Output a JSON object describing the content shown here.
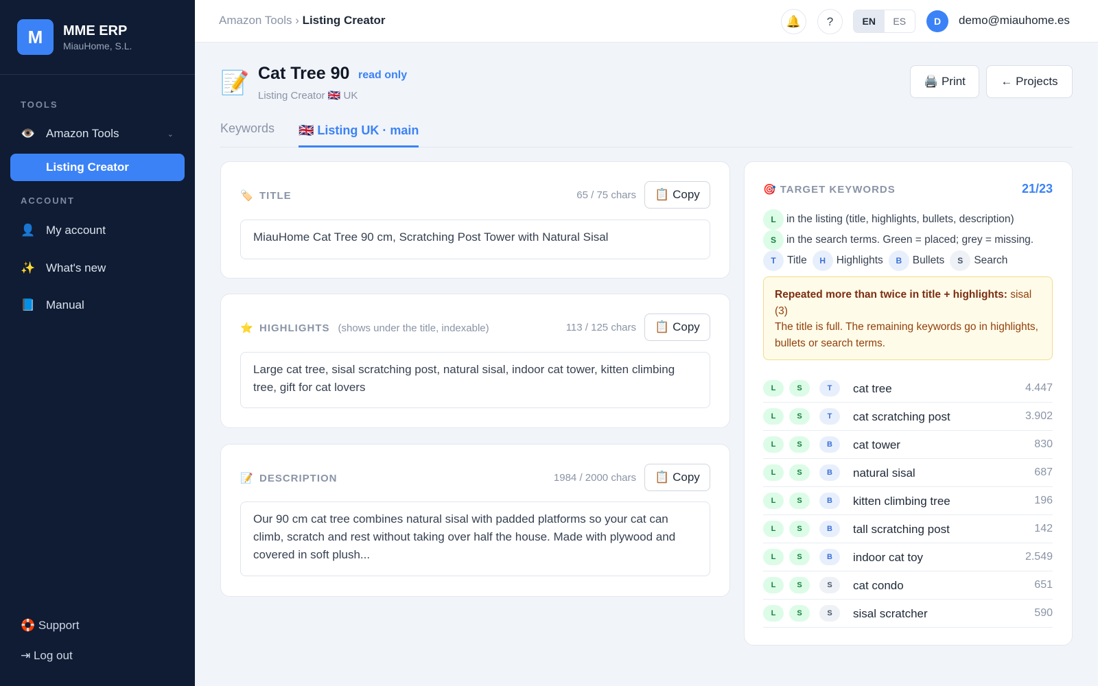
{
  "sidebar": {
    "logo_letter": "M",
    "brand_name": "MME ERP",
    "brand_sub": "MiauHome, S.L.",
    "tools_label": "TOOLS",
    "account_label": "ACCOUNT",
    "amazon_tools": {
      "icon": "👁️",
      "label": "Amazon Tools",
      "chevron": "⌄"
    },
    "listing_creator": "Listing Creator",
    "my_account": {
      "icon": "👤",
      "label": "My account"
    },
    "whats_new": {
      "icon": "✨",
      "label": "What's new"
    },
    "manual": {
      "icon": "📘",
      "label": "Manual"
    },
    "support": "🛟 Support",
    "logout": "⇥ Log out"
  },
  "topbar": {
    "crumb_parent": "Amazon Tools",
    "crumb_sep": " › ",
    "crumb_current": "Listing Creator",
    "bell_icon": "🔔",
    "help_icon": "?",
    "lang_en": "EN",
    "lang_es": "ES",
    "avatar_letter": "D",
    "email": "demo@miauhome.es"
  },
  "header": {
    "icon": "📝",
    "title": "Cat Tree 90",
    "readonly": "read only",
    "subtitle": "Listing Creator 🇬🇧 UK",
    "print_label": "🖨️ Print",
    "projects_label": "← Projects"
  },
  "tabs": {
    "keywords": "Keywords",
    "listing": "🇬🇧 Listing UK · main"
  },
  "title_card": {
    "icon": "🏷️",
    "label": "TITLE",
    "chars": "65 / 75 chars",
    "copy": "📋 Copy",
    "text": "MiauHome Cat Tree 90 cm, Scratching Post Tower with Natural Sisal"
  },
  "highlights_card": {
    "icon": "⭐",
    "label": "HIGHLIGHTS",
    "hint": "(shows under the title, indexable)",
    "chars": "113 / 125 chars",
    "copy": "📋 Copy",
    "text": "Large cat tree, sisal scratching post, natural sisal, indoor cat tower, kitten climbing tree, gift for cat lovers"
  },
  "description_card": {
    "icon": "📝",
    "label": "DESCRIPTION",
    "chars": "1984 / 2000 chars",
    "copy": "📋 Copy",
    "text": "Our 90 cm cat tree combines natural sisal with padded platforms so your cat can climb, scratch and rest without taking over half the house. Made with plywood and covered in soft plush..."
  },
  "keywords_panel": {
    "icon": "🎯",
    "label": "TARGET KEYWORDS",
    "count": "21/23",
    "legend_l": "in the listing (title, highlights, bullets, description)",
    "legend_s": "in the search terms. Green = placed; grey = missing.",
    "legend_t": "Title",
    "legend_h": "Highlights",
    "legend_b": "Bullets",
    "legend_search": "Search",
    "warning_bold": "Repeated more than twice in title + highlights:",
    "warning_rest": " sisal (3)",
    "warning_line2": "The title is full. The remaining keywords go in highlights, bullets or search terms.",
    "rows": [
      {
        "l": "L",
        "s": "S",
        "loc": "T",
        "keyword": "cat tree",
        "volume": "4.447"
      },
      {
        "l": "L",
        "s": "S",
        "loc": "T",
        "keyword": "cat scratching post",
        "volume": "3.902"
      },
      {
        "l": "L",
        "s": "S",
        "loc": "B",
        "keyword": "cat tower",
        "volume": "830"
      },
      {
        "l": "L",
        "s": "S",
        "loc": "B",
        "keyword": "natural sisal",
        "volume": "687"
      },
      {
        "l": "L",
        "s": "S",
        "loc": "B",
        "keyword": "kitten climbing tree",
        "volume": "196"
      },
      {
        "l": "L",
        "s": "S",
        "loc": "B",
        "keyword": "tall scratching post",
        "volume": "142"
      },
      {
        "l": "L",
        "s": "S",
        "loc": "B",
        "keyword": "indoor cat toy",
        "volume": "2.549"
      },
      {
        "l": "L",
        "s": "S",
        "loc": "S",
        "keyword": "cat condo",
        "volume": "651"
      },
      {
        "l": "L",
        "s": "S",
        "loc": "S",
        "keyword": "sisal scratcher",
        "volume": "590"
      }
    ]
  },
  "colors": {
    "accent": "#3b82f6",
    "sidebar_bg": "#0f1c33",
    "placed_green": "#dcfce7",
    "warning_bg": "#fefbe8"
  }
}
